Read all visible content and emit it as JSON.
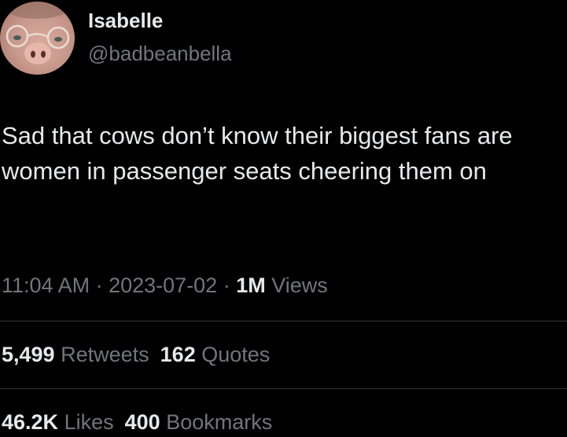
{
  "author": {
    "name": "Isabelle",
    "handle": "@badbeanbella",
    "avatar_icon": "profile-avatar-pig-face"
  },
  "tweet": {
    "text": "Sad that cows don’t know their biggest fans are women in passenger seats cheering them on"
  },
  "meta": {
    "time": "11:04 AM",
    "separator1": " · ",
    "date": "2023-07-02",
    "separator2": " · ",
    "views_count": "1M",
    "views_label": "Views"
  },
  "stats": {
    "retweets_count": "5,499",
    "retweets_label": "Retweets",
    "quotes_count": "162",
    "quotes_label": "Quotes",
    "likes_count": "46.2K",
    "likes_label": "Likes",
    "bookmarks_count": "400",
    "bookmarks_label": "Bookmarks"
  },
  "colors": {
    "background": "#000000",
    "primary_text": "#e7e9ea",
    "secondary_text": "#71767b",
    "divider": "#2f3336"
  }
}
